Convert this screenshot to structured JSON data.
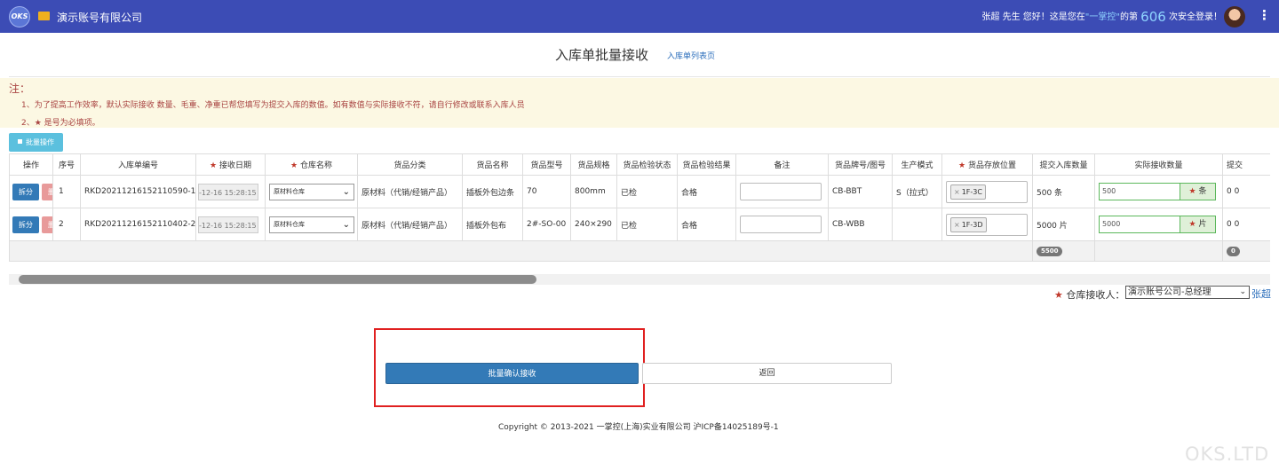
{
  "topbar": {
    "logo_text": "OKS",
    "company": "演示账号有限公司",
    "greeting": {
      "prefix": "张超 先生 您好！这是您在",
      "brand": "\"一掌控\"",
      "middle": "的第",
      "count": "606",
      "suffix": "次安全登录！"
    }
  },
  "page": {
    "title": "入库单批量接收",
    "list_link": "入库单列表页"
  },
  "note": {
    "title": "注：",
    "line1": "1、为了提高工作效率，默认实际接收 数量、毛重、净重已帮您填写为提交入库的数值。如有数值与实际接收不符，请自行修改或联系入库人员",
    "line2_prefix": "2、",
    "line2_star": "★",
    "line2_text": " 是号为必填项。"
  },
  "toolbar": {
    "batch_label": "批量操作"
  },
  "table": {
    "headers": {
      "op": "操作",
      "seq": "序号",
      "code": "入库单编号",
      "date": "接收日期",
      "wh": "仓库名称",
      "cat": "货品分类",
      "name": "货品名称",
      "model": "货品型号",
      "spec": "货品规格",
      "inspect": "货品检验状态",
      "result": "货品检验结果",
      "remark": "备注",
      "brand": "货品牌号/图号",
      "mode": "生产模式",
      "pos": "货品存放位置",
      "submit": "提交入库数量",
      "actual": "实际接收数量",
      "more": "提交"
    },
    "split_label": "拆分",
    "delete_label": "删除",
    "rows": [
      {
        "seq": "1",
        "code": "RKD20211216152110590-1",
        "date": "-12-16 15:28:15",
        "warehouse": "原材料仓库",
        "category": "原材料（代销/经销产品）",
        "name": "插板外包边条",
        "model": "70",
        "spec": "800mm",
        "inspect": "已检",
        "result": "合格",
        "brand": "CB-BBT",
        "mode": "S（拉式）",
        "position": "1F-3C",
        "submit_qty": "500 条",
        "actual_qty": "500",
        "unit": "条",
        "more": "0 0"
      },
      {
        "seq": "2",
        "code": "RKD20211216152110402-2",
        "date": "-12-16 15:28:15",
        "warehouse": "原材料仓库",
        "category": "原材料（代销/经销产品）",
        "name": "插板外包布",
        "model": "2#-SO-00",
        "spec": "240×290",
        "inspect": "已检",
        "result": "合格",
        "brand": "CB-WBB",
        "mode": "",
        "position": "1F-3D",
        "submit_qty": "5000 片",
        "actual_qty": "5000",
        "unit": "片",
        "more": "0 0"
      }
    ],
    "total_submit": "5500",
    "total_more": "0"
  },
  "receiver": {
    "label": "仓库接收人：",
    "selected": "演示账号公司-总经理",
    "extra": "张超"
  },
  "actions": {
    "confirm": "批量确认接收",
    "back": "返回"
  },
  "footer": {
    "copyright": "Copyright © 2013-2021 一掌控(上海)实业有限公司 沪ICP备14025189号-1",
    "watermark": "OKS.LTD"
  },
  "colors": {
    "topbar": "#3c4cb5",
    "primary": "#337ab7",
    "danger_light": "#e89a9a",
    "info": "#5bc0de",
    "highlight_frame": "#e02020",
    "note_bg": "#fcf8e3"
  }
}
